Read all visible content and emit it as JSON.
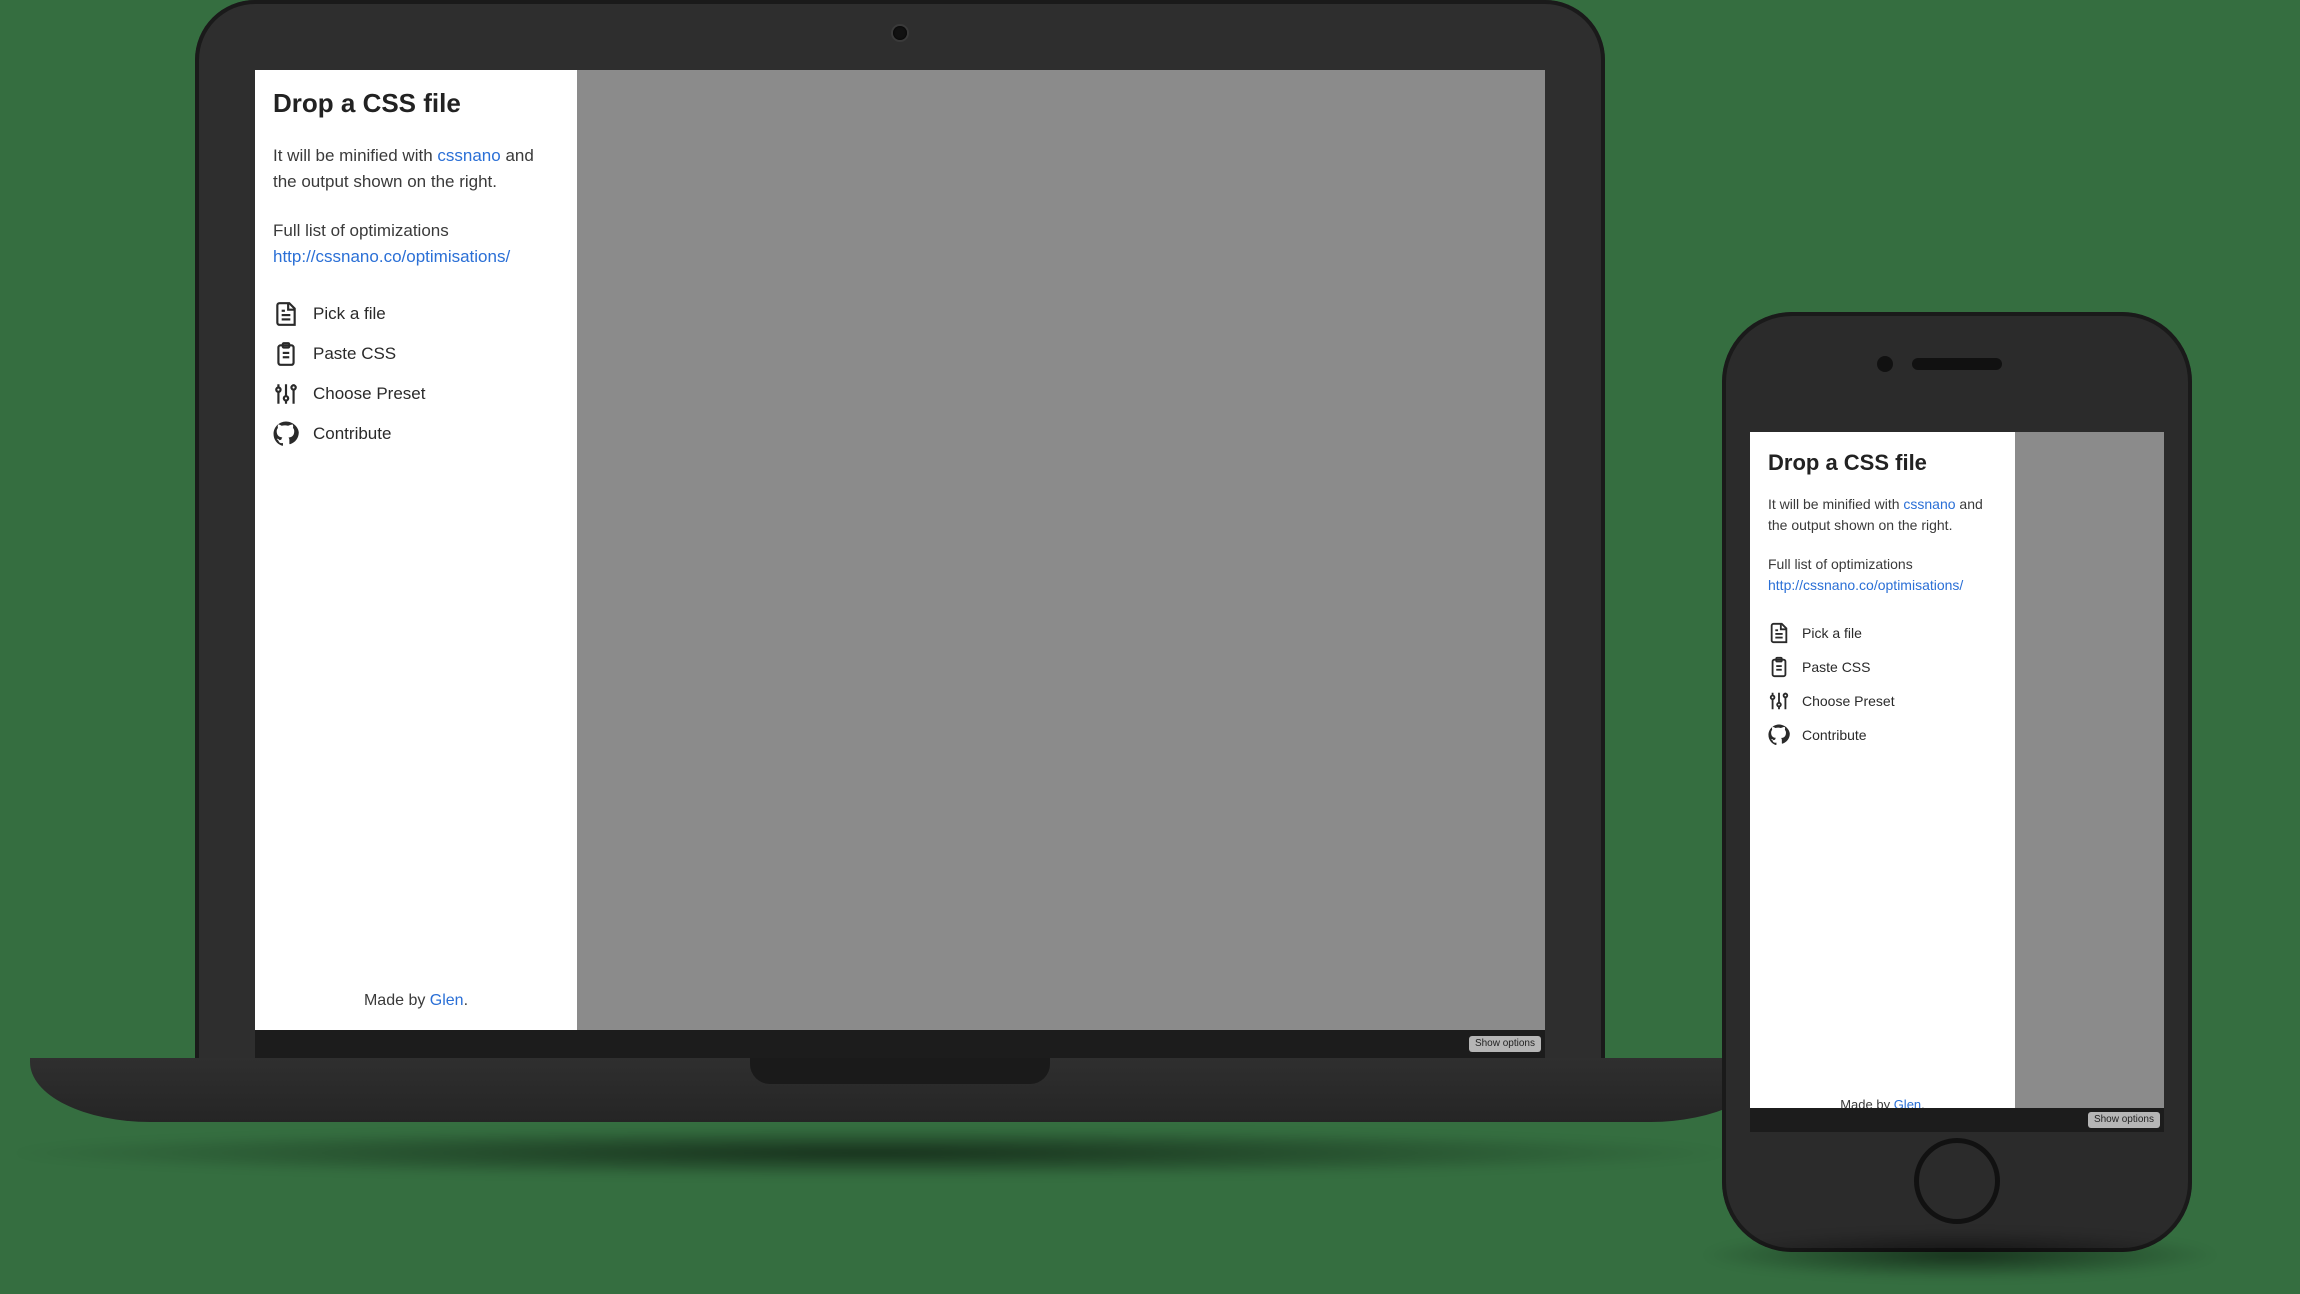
{
  "app": {
    "title": "Drop a CSS file",
    "desc_prefix": "It will be minified with ",
    "desc_link": "cssnano",
    "desc_suffix": " and the output shown on the right.",
    "opt_label": "Full list of optimizations",
    "opt_link": "http://cssnano.co/optimisations/",
    "actions": {
      "pick": "Pick a file",
      "paste": "Paste CSS",
      "preset": "Choose Preset",
      "contribute": "Contribute"
    },
    "footer_prefix": "Made by ",
    "footer_link": "Glen",
    "footer_suffix": "."
  },
  "chrome": {
    "show_options": "Show options"
  }
}
